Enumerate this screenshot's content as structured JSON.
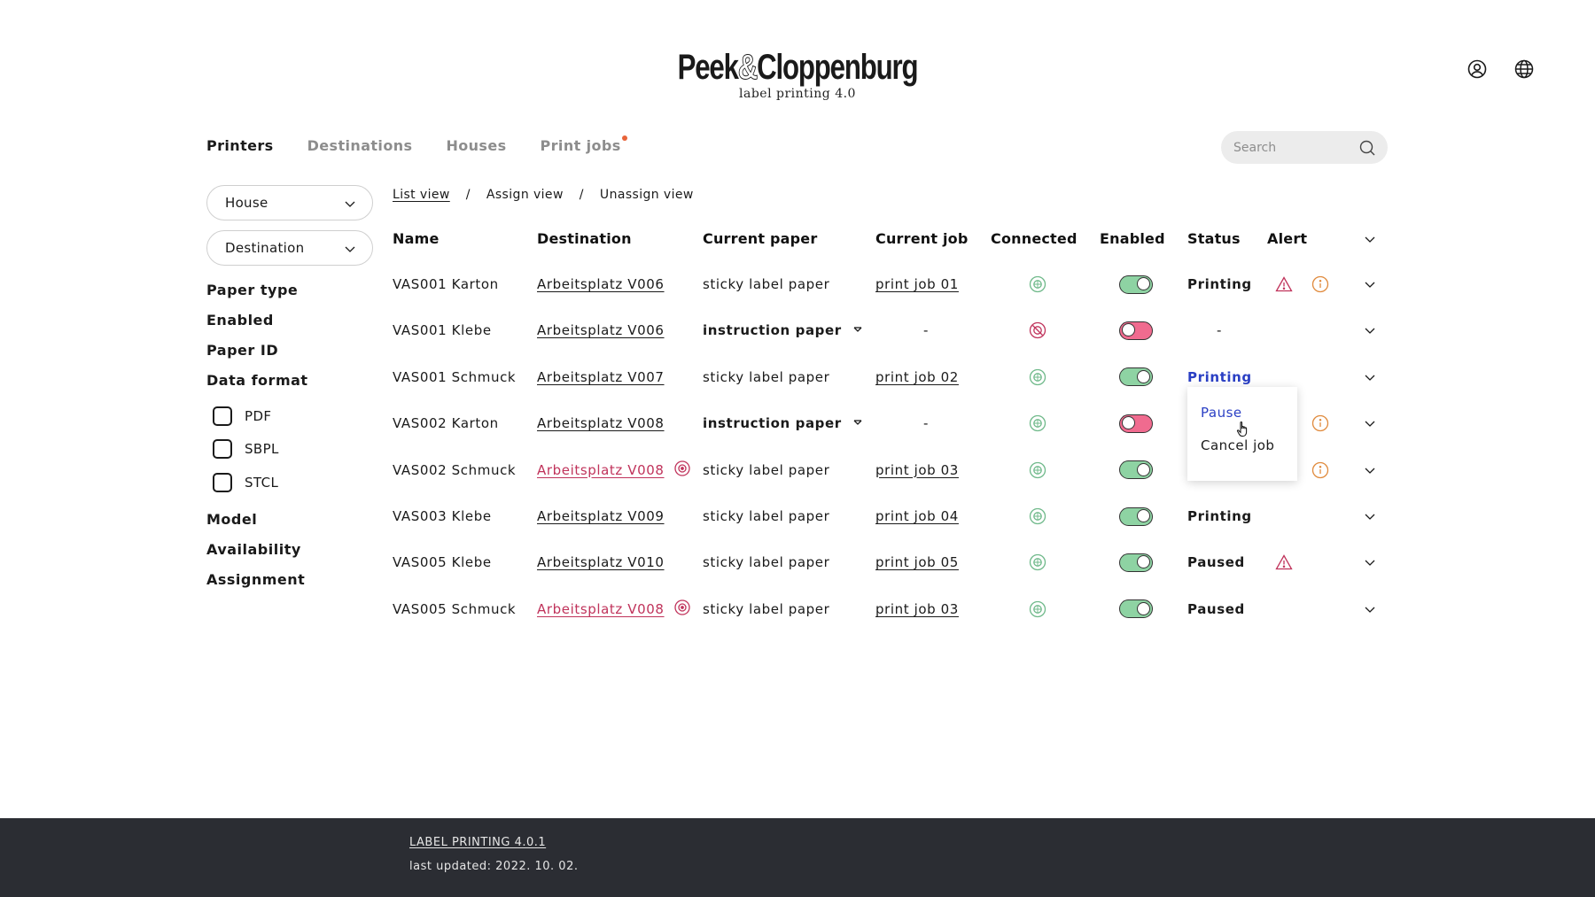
{
  "header": {
    "brand_left": "Peek",
    "brand_amp": "&",
    "brand_right": "Cloppenburg",
    "subtitle": "label printing 4.0",
    "icons": [
      "user-icon",
      "globe-icon"
    ]
  },
  "nav": {
    "tabs": [
      {
        "label": "Printers",
        "active": true
      },
      {
        "label": "Destinations",
        "active": false
      },
      {
        "label": "Houses",
        "active": false
      },
      {
        "label": "Print jobs",
        "active": false,
        "notification": true
      }
    ],
    "search_placeholder": "Search"
  },
  "sidebar": {
    "house_label": "House",
    "destination_label": "Destination",
    "filters": {
      "paper_type": "Paper type",
      "enabled": "Enabled",
      "paper_id": "Paper ID",
      "data_format": "Data format",
      "model": "Model",
      "availability": "Availability",
      "assignment": "Assignment"
    },
    "formats": [
      "PDF",
      "SBPL",
      "STCL"
    ]
  },
  "views": {
    "list": "List view",
    "sep1": "/",
    "assign": "Assign view",
    "sep2": "/",
    "unassign": "Unassign view"
  },
  "table": {
    "headers": {
      "name": "Name",
      "destination": "Destination",
      "paper": "Current paper",
      "job": "Current job",
      "connected": "Connected",
      "enabled": "Enabled",
      "status": "Status",
      "alert": "Alert"
    },
    "rows": [
      {
        "name": "VAS001 Karton",
        "destination": "Arbeitsplatz V006",
        "dest_flag": false,
        "paper": "sticky label paper",
        "paper_dropdown": false,
        "job": "print job 01",
        "connected": true,
        "enabled": true,
        "status": "Printing",
        "warn": true,
        "info": true
      },
      {
        "name": "VAS001 Klebe",
        "destination": "Arbeitsplatz V006",
        "dest_flag": false,
        "paper": "instruction paper",
        "paper_dropdown": true,
        "job": "-",
        "connected": false,
        "enabled": false,
        "status": "-",
        "warn": false,
        "info": false
      },
      {
        "name": "VAS001 Schmuck",
        "destination": "Arbeitsplatz V007",
        "dest_flag": false,
        "paper": "sticky label paper",
        "paper_dropdown": false,
        "job": "print job 02",
        "connected": true,
        "enabled": true,
        "status": "Printing",
        "status_active": true,
        "warn": false,
        "info": false
      },
      {
        "name": "VAS002 Karton",
        "destination": "Arbeitsplatz V008",
        "dest_flag": false,
        "paper": "instruction paper",
        "paper_dropdown": true,
        "job": "-",
        "connected": true,
        "enabled": false,
        "status": "",
        "warn": false,
        "info": true
      },
      {
        "name": "VAS002 Schmuck",
        "destination": "Arbeitsplatz V008",
        "dest_flag": true,
        "paper": "sticky label paper",
        "paper_dropdown": false,
        "job": "print job 03",
        "connected": true,
        "enabled": true,
        "status": "",
        "warn": false,
        "info": true
      },
      {
        "name": "VAS003 Klebe",
        "destination": "Arbeitsplatz V009",
        "dest_flag": false,
        "paper": "sticky label paper",
        "paper_dropdown": false,
        "job": "print job 04",
        "connected": true,
        "enabled": true,
        "status": "Printing",
        "warn": false,
        "info": false
      },
      {
        "name": "VAS005 Klebe",
        "destination": "Arbeitsplatz V010",
        "dest_flag": false,
        "paper": "sticky label paper",
        "paper_dropdown": false,
        "job": "print job 05",
        "connected": true,
        "enabled": true,
        "status": "Paused",
        "warn": true,
        "info": false
      },
      {
        "name": "VAS005 Schmuck",
        "destination": "Arbeitsplatz V008",
        "dest_flag": true,
        "paper": "sticky label paper",
        "paper_dropdown": false,
        "job": "print job 03",
        "connected": true,
        "enabled": true,
        "status": "Paused",
        "warn": false,
        "info": false
      }
    ]
  },
  "popup": {
    "items": [
      "Pause",
      "Cancel job"
    ]
  },
  "footer": {
    "version": "LABEL PRINTING 4.0.1",
    "updated": "last updated: 2022. 10. 02."
  },
  "colors": {
    "accent_blue": "#2a3fc4",
    "alert_red": "#c0335b",
    "info_orange": "#e08a3c",
    "toggle_on": "#8ed3a3",
    "toggle_off": "#f06b8f",
    "footer_bg": "#2b2d33"
  }
}
